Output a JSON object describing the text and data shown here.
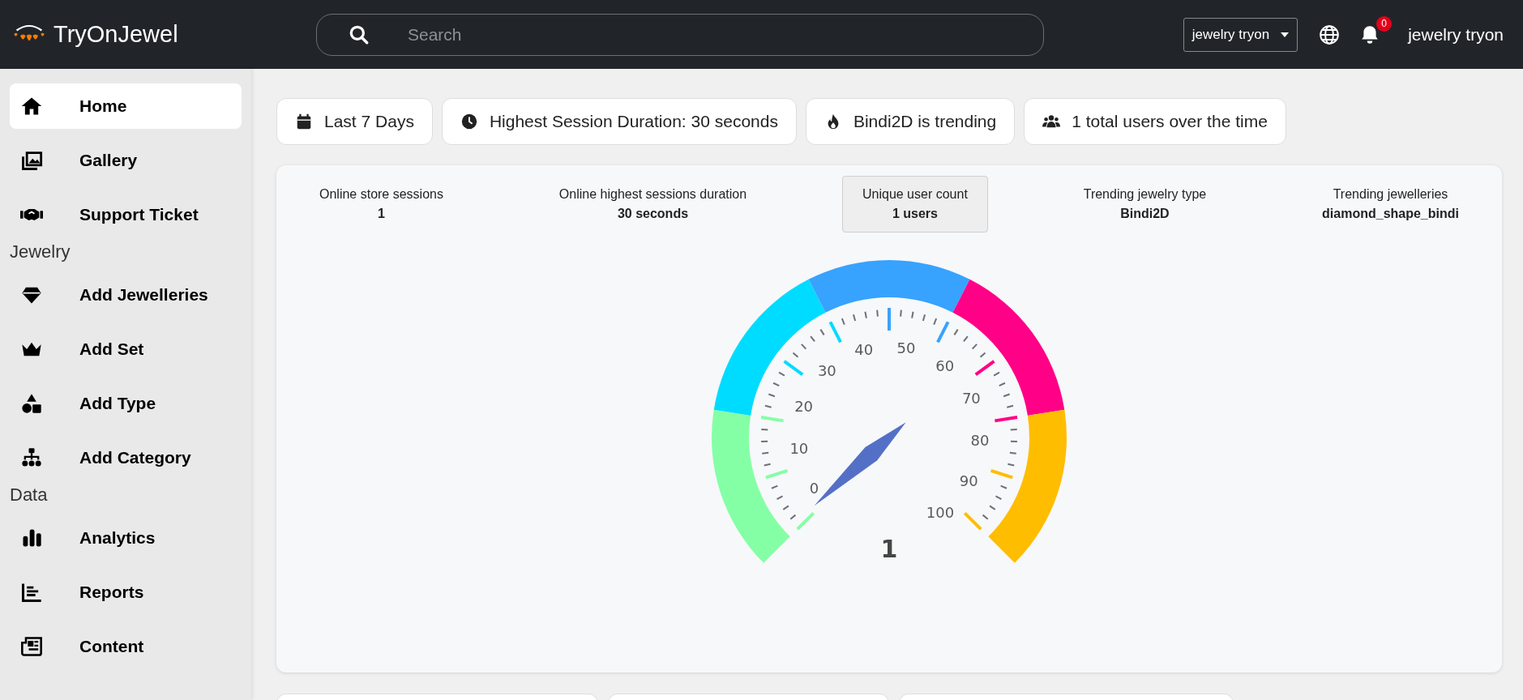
{
  "app": {
    "name": "TryOnJewel"
  },
  "search": {
    "placeholder": "Search"
  },
  "account_dropdown": {
    "value": "jewelry tryon"
  },
  "notifications": {
    "count": "0"
  },
  "user": {
    "name": "jewelry tryon"
  },
  "sidebar": {
    "sections": [
      {
        "items": [
          {
            "label": "Home",
            "selected": true
          },
          {
            "label": "Gallery",
            "selected": false
          },
          {
            "label": "Support Ticket",
            "selected": false
          }
        ]
      },
      {
        "heading": "Jewelry",
        "items": [
          {
            "label": "Add Jewelleries",
            "selected": false
          },
          {
            "label": "Add Set",
            "selected": false
          },
          {
            "label": "Add Type",
            "selected": false
          },
          {
            "label": "Add Category",
            "selected": false
          }
        ]
      },
      {
        "heading": "Data",
        "items": [
          {
            "label": "Analytics",
            "selected": false
          },
          {
            "label": "Reports",
            "selected": false
          },
          {
            "label": "Content",
            "selected": false
          }
        ]
      }
    ]
  },
  "summary_pills": [
    "Last 7 Days",
    "Highest Session Duration: 30 seconds",
    "Bindi2D is trending",
    "1 total users over the time"
  ],
  "stats": [
    {
      "label": "Online store sessions",
      "value": "1",
      "selected": false
    },
    {
      "label": "Online highest sessions duration",
      "value": "30 seconds",
      "selected": false
    },
    {
      "label": "Unique user count",
      "value": "1 users",
      "selected": true
    },
    {
      "label": "Trending jewelry type",
      "value": "Bindi2D",
      "selected": false
    },
    {
      "label": "Trending jewelleries",
      "value": "diamond_shape_bindi",
      "selected": false
    }
  ],
  "gauge": {
    "value_label": "1",
    "tick_labels": [
      "0",
      "10",
      "20",
      "30",
      "40",
      "50",
      "60",
      "70",
      "80",
      "90",
      "100"
    ],
    "bands": [
      {
        "color": "#85ffa6"
      },
      {
        "color": "#00dcff"
      },
      {
        "color": "#38a2ff"
      },
      {
        "color": "#ff0087"
      },
      {
        "color": "#ffbd00"
      }
    ]
  }
}
